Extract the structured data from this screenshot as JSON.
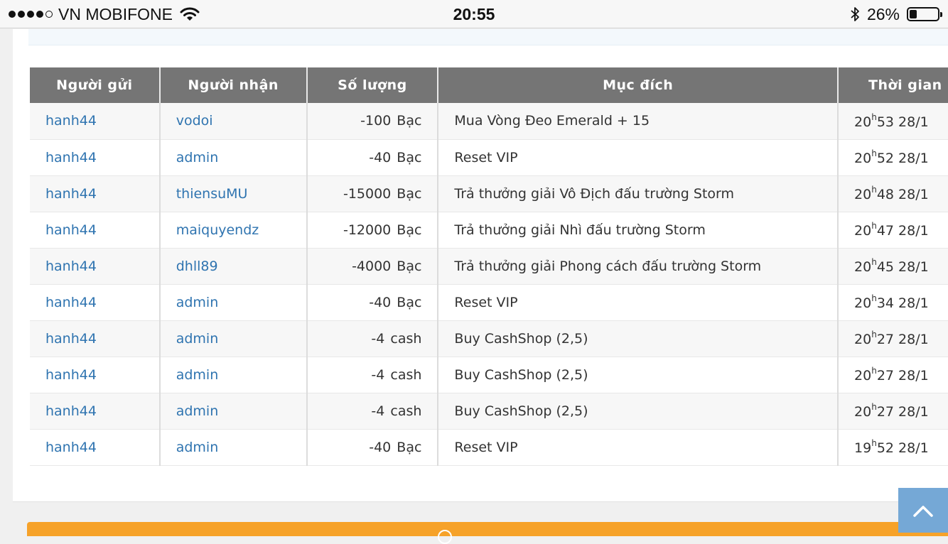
{
  "status_bar": {
    "carrier": "VN MOBIFONE",
    "time": "20:55",
    "battery_text": "26%",
    "battery_level": 0.26,
    "signal_bars_filled": 4,
    "signal_bars_total": 5,
    "icons": [
      "wifi-icon",
      "bluetooth-icon",
      "battery-icon"
    ]
  },
  "table": {
    "headers": {
      "sender": "Người gửi",
      "receiver": "Người nhận",
      "amount": "Số lượng",
      "purpose": "Mục đích",
      "time": "Thời gian"
    },
    "rows": [
      {
        "sender": "hanh44",
        "receiver": "vodoi",
        "amount": "-100",
        "unit": "Bạc",
        "purpose": "Mua Vòng Đeo Emerald + 15",
        "hour": "20",
        "h": "h",
        "rest": "53 28/1"
      },
      {
        "sender": "hanh44",
        "receiver": "admin",
        "amount": "-40",
        "unit": "Bạc",
        "purpose": "Reset VIP",
        "hour": "20",
        "h": "h",
        "rest": "52 28/1"
      },
      {
        "sender": "hanh44",
        "receiver": "thiensuMU",
        "amount": "-15000",
        "unit": "Bạc",
        "purpose": "Trả thưởng giải Vô Địch đấu trường Storm",
        "hour": "20",
        "h": "h",
        "rest": "48 28/1"
      },
      {
        "sender": "hanh44",
        "receiver": "maiquyendz",
        "amount": "-12000",
        "unit": "Bạc",
        "purpose": "Trả thưởng giải Nhì đấu trường Storm",
        "hour": "20",
        "h": "h",
        "rest": "47 28/1"
      },
      {
        "sender": "hanh44",
        "receiver": "dhll89",
        "amount": "-4000",
        "unit": "Bạc",
        "purpose": "Trả thưởng giải Phong cách đấu trường Storm",
        "hour": "20",
        "h": "h",
        "rest": "45 28/1"
      },
      {
        "sender": "hanh44",
        "receiver": "admin",
        "amount": "-40",
        "unit": "Bạc",
        "purpose": "Reset VIP",
        "hour": "20",
        "h": "h",
        "rest": "34 28/1"
      },
      {
        "sender": "hanh44",
        "receiver": "admin",
        "amount": "-4",
        "unit": "cash",
        "purpose": "Buy CashShop (2,5)",
        "hour": "20",
        "h": "h",
        "rest": "27 28/1"
      },
      {
        "sender": "hanh44",
        "receiver": "admin",
        "amount": "-4",
        "unit": "cash",
        "purpose": "Buy CashShop (2,5)",
        "hour": "20",
        "h": "h",
        "rest": "27 28/1"
      },
      {
        "sender": "hanh44",
        "receiver": "admin",
        "amount": "-4",
        "unit": "cash",
        "purpose": "Buy CashShop (2,5)",
        "hour": "20",
        "h": "h",
        "rest": "27 28/1"
      },
      {
        "sender": "hanh44",
        "receiver": "admin",
        "amount": "-40",
        "unit": "Bạc",
        "purpose": "Reset VIP",
        "hour": "19",
        "h": "h",
        "rest": "52 28/1"
      }
    ]
  },
  "colors": {
    "header_bg": "#757575",
    "link": "#2f74b0",
    "accent_orange": "#f6a229",
    "scroll_button": "#75a8d6"
  },
  "scroll_top_icon": "chevron-up-icon"
}
